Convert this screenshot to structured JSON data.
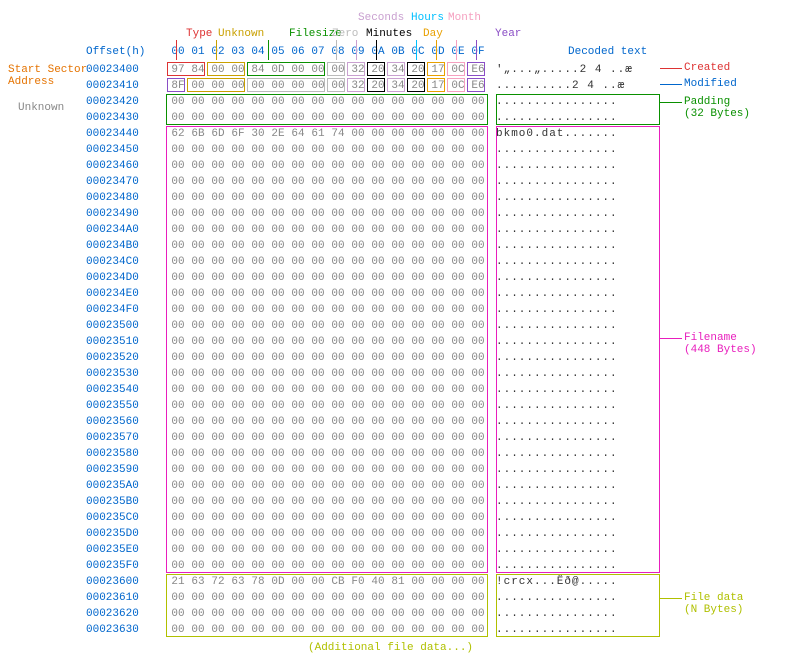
{
  "header": {
    "offsetLabel": "Offset(h)",
    "cols": [
      "00",
      "01",
      "02",
      "03",
      "04",
      "05",
      "06",
      "07",
      "08",
      "09",
      "0A",
      "0B",
      "0C",
      "0D",
      "0E",
      "0F"
    ],
    "decodedLabel": "Decoded text",
    "fieldLabels": {
      "type": "Type",
      "unknown": "Unknown",
      "filesize": "Filesize",
      "zeroSecs": "Zero",
      "seconds": "Seconds",
      "minutes": "Minutes",
      "hours": "Hours",
      "day": "Day",
      "month": "Month",
      "year": "Year"
    }
  },
  "colors": {
    "type": "#d33",
    "unknown": "#c9a000",
    "filesize": "#0a9000",
    "zeroSecs": "#bbb",
    "seconds": "#c9a0d0",
    "minutes": "#000",
    "hours": "#00bfff",
    "day": "#e8a000",
    "month": "#f5a0c0",
    "year": "#8a4ec5",
    "startSector": "#e57300",
    "unknownSide": "#888",
    "created": "#d33",
    "modified": "#0066cc",
    "padding": "#0a9000",
    "filename": "#e81ebd",
    "filedata": "#b0c000",
    "offset": "#0066cc"
  },
  "sideLabels": {
    "startSector": "Start Sector\nAddress",
    "unknown": "Unknown",
    "created": "Created",
    "modified": "Modified",
    "padding": "Padding\n(32 Bytes)",
    "filename": "Filename\n(448 Bytes)",
    "filedata": "File data\n(N Bytes)",
    "additional": "(Additional file data...)"
  },
  "rows": [
    {
      "o": "00023400",
      "h": [
        "97",
        "84",
        "00",
        "00",
        "84",
        "0D",
        "00",
        "00",
        "00",
        "32",
        "20",
        "34",
        "20",
        "17",
        "0C",
        "E6"
      ],
      "d": "'„...„.....2 4 ..æ"
    },
    {
      "o": "00023410",
      "h": [
        "8F",
        "00",
        "00",
        "00",
        "00",
        "00",
        "00",
        "00",
        "00",
        "32",
        "20",
        "34",
        "20",
        "17",
        "0C",
        "E6"
      ],
      "d": "..........2 4 ..æ"
    },
    {
      "o": "00023420",
      "h": [
        "00",
        "00",
        "00",
        "00",
        "00",
        "00",
        "00",
        "00",
        "00",
        "00",
        "00",
        "00",
        "00",
        "00",
        "00",
        "00"
      ],
      "d": "................"
    },
    {
      "o": "00023430",
      "h": [
        "00",
        "00",
        "00",
        "00",
        "00",
        "00",
        "00",
        "00",
        "00",
        "00",
        "00",
        "00",
        "00",
        "00",
        "00",
        "00"
      ],
      "d": "................"
    },
    {
      "o": "00023440",
      "h": [
        "62",
        "6B",
        "6D",
        "6F",
        "30",
        "2E",
        "64",
        "61",
        "74",
        "00",
        "00",
        "00",
        "00",
        "00",
        "00",
        "00"
      ],
      "d": "bkmo0.dat......."
    },
    {
      "o": "00023450",
      "h": [
        "00",
        "00",
        "00",
        "00",
        "00",
        "00",
        "00",
        "00",
        "00",
        "00",
        "00",
        "00",
        "00",
        "00",
        "00",
        "00"
      ],
      "d": "................"
    },
    {
      "o": "00023460",
      "h": [
        "00",
        "00",
        "00",
        "00",
        "00",
        "00",
        "00",
        "00",
        "00",
        "00",
        "00",
        "00",
        "00",
        "00",
        "00",
        "00"
      ],
      "d": "................"
    },
    {
      "o": "00023470",
      "h": [
        "00",
        "00",
        "00",
        "00",
        "00",
        "00",
        "00",
        "00",
        "00",
        "00",
        "00",
        "00",
        "00",
        "00",
        "00",
        "00"
      ],
      "d": "................"
    },
    {
      "o": "00023480",
      "h": [
        "00",
        "00",
        "00",
        "00",
        "00",
        "00",
        "00",
        "00",
        "00",
        "00",
        "00",
        "00",
        "00",
        "00",
        "00",
        "00"
      ],
      "d": "................"
    },
    {
      "o": "00023490",
      "h": [
        "00",
        "00",
        "00",
        "00",
        "00",
        "00",
        "00",
        "00",
        "00",
        "00",
        "00",
        "00",
        "00",
        "00",
        "00",
        "00"
      ],
      "d": "................"
    },
    {
      "o": "000234A0",
      "h": [
        "00",
        "00",
        "00",
        "00",
        "00",
        "00",
        "00",
        "00",
        "00",
        "00",
        "00",
        "00",
        "00",
        "00",
        "00",
        "00"
      ],
      "d": "................"
    },
    {
      "o": "000234B0",
      "h": [
        "00",
        "00",
        "00",
        "00",
        "00",
        "00",
        "00",
        "00",
        "00",
        "00",
        "00",
        "00",
        "00",
        "00",
        "00",
        "00"
      ],
      "d": "................"
    },
    {
      "o": "000234C0",
      "h": [
        "00",
        "00",
        "00",
        "00",
        "00",
        "00",
        "00",
        "00",
        "00",
        "00",
        "00",
        "00",
        "00",
        "00",
        "00",
        "00"
      ],
      "d": "................"
    },
    {
      "o": "000234D0",
      "h": [
        "00",
        "00",
        "00",
        "00",
        "00",
        "00",
        "00",
        "00",
        "00",
        "00",
        "00",
        "00",
        "00",
        "00",
        "00",
        "00"
      ],
      "d": "................"
    },
    {
      "o": "000234E0",
      "h": [
        "00",
        "00",
        "00",
        "00",
        "00",
        "00",
        "00",
        "00",
        "00",
        "00",
        "00",
        "00",
        "00",
        "00",
        "00",
        "00"
      ],
      "d": "................"
    },
    {
      "o": "000234F0",
      "h": [
        "00",
        "00",
        "00",
        "00",
        "00",
        "00",
        "00",
        "00",
        "00",
        "00",
        "00",
        "00",
        "00",
        "00",
        "00",
        "00"
      ],
      "d": "................"
    },
    {
      "o": "00023500",
      "h": [
        "00",
        "00",
        "00",
        "00",
        "00",
        "00",
        "00",
        "00",
        "00",
        "00",
        "00",
        "00",
        "00",
        "00",
        "00",
        "00"
      ],
      "d": "................"
    },
    {
      "o": "00023510",
      "h": [
        "00",
        "00",
        "00",
        "00",
        "00",
        "00",
        "00",
        "00",
        "00",
        "00",
        "00",
        "00",
        "00",
        "00",
        "00",
        "00"
      ],
      "d": "................"
    },
    {
      "o": "00023520",
      "h": [
        "00",
        "00",
        "00",
        "00",
        "00",
        "00",
        "00",
        "00",
        "00",
        "00",
        "00",
        "00",
        "00",
        "00",
        "00",
        "00"
      ],
      "d": "................"
    },
    {
      "o": "00023530",
      "h": [
        "00",
        "00",
        "00",
        "00",
        "00",
        "00",
        "00",
        "00",
        "00",
        "00",
        "00",
        "00",
        "00",
        "00",
        "00",
        "00"
      ],
      "d": "................"
    },
    {
      "o": "00023540",
      "h": [
        "00",
        "00",
        "00",
        "00",
        "00",
        "00",
        "00",
        "00",
        "00",
        "00",
        "00",
        "00",
        "00",
        "00",
        "00",
        "00"
      ],
      "d": "................"
    },
    {
      "o": "00023550",
      "h": [
        "00",
        "00",
        "00",
        "00",
        "00",
        "00",
        "00",
        "00",
        "00",
        "00",
        "00",
        "00",
        "00",
        "00",
        "00",
        "00"
      ],
      "d": "................"
    },
    {
      "o": "00023560",
      "h": [
        "00",
        "00",
        "00",
        "00",
        "00",
        "00",
        "00",
        "00",
        "00",
        "00",
        "00",
        "00",
        "00",
        "00",
        "00",
        "00"
      ],
      "d": "................"
    },
    {
      "o": "00023570",
      "h": [
        "00",
        "00",
        "00",
        "00",
        "00",
        "00",
        "00",
        "00",
        "00",
        "00",
        "00",
        "00",
        "00",
        "00",
        "00",
        "00"
      ],
      "d": "................"
    },
    {
      "o": "00023580",
      "h": [
        "00",
        "00",
        "00",
        "00",
        "00",
        "00",
        "00",
        "00",
        "00",
        "00",
        "00",
        "00",
        "00",
        "00",
        "00",
        "00"
      ],
      "d": "................"
    },
    {
      "o": "00023590",
      "h": [
        "00",
        "00",
        "00",
        "00",
        "00",
        "00",
        "00",
        "00",
        "00",
        "00",
        "00",
        "00",
        "00",
        "00",
        "00",
        "00"
      ],
      "d": "................"
    },
    {
      "o": "000235A0",
      "h": [
        "00",
        "00",
        "00",
        "00",
        "00",
        "00",
        "00",
        "00",
        "00",
        "00",
        "00",
        "00",
        "00",
        "00",
        "00",
        "00"
      ],
      "d": "................"
    },
    {
      "o": "000235B0",
      "h": [
        "00",
        "00",
        "00",
        "00",
        "00",
        "00",
        "00",
        "00",
        "00",
        "00",
        "00",
        "00",
        "00",
        "00",
        "00",
        "00"
      ],
      "d": "................"
    },
    {
      "o": "000235C0",
      "h": [
        "00",
        "00",
        "00",
        "00",
        "00",
        "00",
        "00",
        "00",
        "00",
        "00",
        "00",
        "00",
        "00",
        "00",
        "00",
        "00"
      ],
      "d": "................"
    },
    {
      "o": "000235D0",
      "h": [
        "00",
        "00",
        "00",
        "00",
        "00",
        "00",
        "00",
        "00",
        "00",
        "00",
        "00",
        "00",
        "00",
        "00",
        "00",
        "00"
      ],
      "d": "................"
    },
    {
      "o": "000235E0",
      "h": [
        "00",
        "00",
        "00",
        "00",
        "00",
        "00",
        "00",
        "00",
        "00",
        "00",
        "00",
        "00",
        "00",
        "00",
        "00",
        "00"
      ],
      "d": "................"
    },
    {
      "o": "000235F0",
      "h": [
        "00",
        "00",
        "00",
        "00",
        "00",
        "00",
        "00",
        "00",
        "00",
        "00",
        "00",
        "00",
        "00",
        "00",
        "00",
        "00"
      ],
      "d": "................"
    },
    {
      "o": "00023600",
      "h": [
        "21",
        "63",
        "72",
        "63",
        "78",
        "0D",
        "00",
        "00",
        "CB",
        "F0",
        "40",
        "81",
        "00",
        "00",
        "00",
        "00"
      ],
      "d": "!crcx...Ëð@....."
    },
    {
      "o": "00023610",
      "h": [
        "00",
        "00",
        "00",
        "00",
        "00",
        "00",
        "00",
        "00",
        "00",
        "00",
        "00",
        "00",
        "00",
        "00",
        "00",
        "00"
      ],
      "d": "................"
    },
    {
      "o": "00023620",
      "h": [
        "00",
        "00",
        "00",
        "00",
        "00",
        "00",
        "00",
        "00",
        "00",
        "00",
        "00",
        "00",
        "00",
        "00",
        "00",
        "00"
      ],
      "d": "................"
    },
    {
      "o": "00023630",
      "h": [
        "00",
        "00",
        "00",
        "00",
        "00",
        "00",
        "00",
        "00",
        "00",
        "00",
        "00",
        "00",
        "00",
        "00",
        "00",
        "00"
      ],
      "d": "................"
    }
  ],
  "fieldBoxes": [
    {
      "row": 0,
      "c0": 0,
      "c1": 1,
      "clr": "type"
    },
    {
      "row": 0,
      "c0": 2,
      "c1": 3,
      "clr": "unknown"
    },
    {
      "row": 0,
      "c0": 4,
      "c1": 7,
      "clr": "filesize"
    },
    {
      "row": 0,
      "c0": 8,
      "c1": 8,
      "clr": "zeroSecs"
    },
    {
      "row": 0,
      "c0": 9,
      "c1": 9,
      "clr": "seconds"
    },
    {
      "row": 0,
      "c0": 10,
      "c1": 10,
      "clr": "minutes"
    },
    {
      "row": 0,
      "c0": 11,
      "c1": 11,
      "clr": "seconds"
    },
    {
      "row": 0,
      "c0": 12,
      "c1": 12,
      "clr": "minutes"
    },
    {
      "row": 0,
      "c0": 13,
      "c1": 13,
      "clr": "day"
    },
    {
      "row": 0,
      "c0": 14,
      "c1": 14,
      "clr": "month"
    },
    {
      "row": 0,
      "c0": 15,
      "c1": 15,
      "clr": "year"
    },
    {
      "row": 1,
      "c0": 0,
      "c1": 0,
      "clr": "year"
    },
    {
      "row": 1,
      "c0": 1,
      "c1": 3,
      "clr": "unknown"
    },
    {
      "row": 1,
      "c0": 4,
      "c1": 7,
      "clr": "zeroSecs"
    },
    {
      "row": 1,
      "c0": 8,
      "c1": 8,
      "clr": "zeroSecs"
    },
    {
      "row": 1,
      "c0": 9,
      "c1": 9,
      "clr": "seconds"
    },
    {
      "row": 1,
      "c0": 10,
      "c1": 10,
      "clr": "minutes"
    },
    {
      "row": 1,
      "c0": 11,
      "c1": 11,
      "clr": "seconds"
    },
    {
      "row": 1,
      "c0": 12,
      "c1": 12,
      "clr": "minutes"
    },
    {
      "row": 1,
      "c0": 13,
      "c1": 13,
      "clr": "day"
    },
    {
      "row": 1,
      "c0": 14,
      "c1": 14,
      "clr": "month"
    },
    {
      "row": 1,
      "c0": 15,
      "c1": 15,
      "clr": "year"
    }
  ],
  "groups": [
    {
      "r0": 2,
      "r1": 3,
      "clr": "padding",
      "dec": true
    },
    {
      "r0": 4,
      "r1": 31,
      "clr": "filename",
      "dec": true
    },
    {
      "r0": 32,
      "r1": 35,
      "clr": "filedata",
      "dec": true
    }
  ]
}
